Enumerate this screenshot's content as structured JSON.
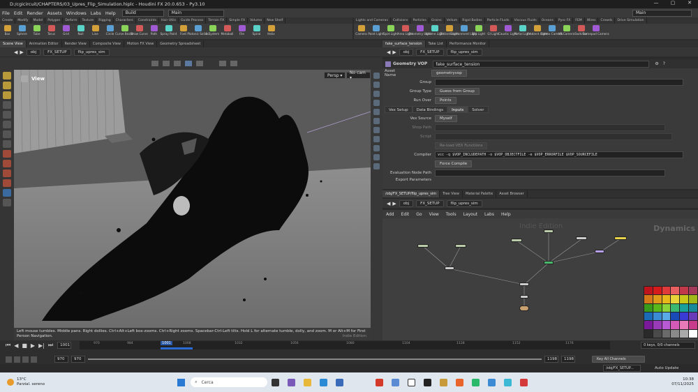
{
  "window": {
    "title": "D:/cgicircuit/CHAPTERS/03_Upres_Flip_Simulation.hiplc - Houdini FX 20.0.653 - Py3.10",
    "min": "—",
    "max": "▢",
    "close": "✕"
  },
  "menu": {
    "items": [
      "File",
      "Edit",
      "Render",
      "Assets",
      "Windows",
      "Labs",
      "Help"
    ],
    "build": "Build",
    "main_desk": "Main",
    "right_desk": "Main"
  },
  "shelf_tabs_left": [
    "Create",
    "Modify",
    "Model",
    "Polygon",
    "Deform",
    "Texture",
    "Rigging",
    "Characters",
    "Constraints",
    "Hair Utils",
    "Guide Process",
    "Terrain FX",
    "Simple FX",
    "Volume",
    "New Shelf"
  ],
  "shelf_tools_left": [
    "Box",
    "Sphere",
    "Tube",
    "Torus",
    "Grid",
    "Null",
    "Line",
    "Circle",
    "Curve Bezier",
    "Draw Curve",
    "Path",
    "Spray Paint",
    "Font",
    "Platonic Solids",
    "L-System",
    "Metaball",
    "File",
    "Spiral",
    "Helix"
  ],
  "shelf_tabs_right": [
    "Lights and Cameras",
    "Collisions",
    "Particles",
    "Grains",
    "Vellum",
    "Rigid Bodies",
    "Particle Fluids",
    "Viscous Fluids",
    "Oceans",
    "Pyro FX",
    "FEM",
    "Wires",
    "Crowds",
    "Drive Simulation"
  ],
  "shelf_tools_right": [
    "Camera",
    "Point Light",
    "Spot Light",
    "Area Light",
    "Geometry Light",
    "Volume Light",
    "Distant Light",
    "Environment Light",
    "Sky Light",
    "GI Light",
    "Caustic Light",
    "Portal Light",
    "Ambient Light",
    "Stereo Camera",
    "VR Camera",
    "Switcher",
    "Gamepad Camera"
  ],
  "left_tabs": [
    "Scene View",
    "Animation Editor",
    "Render View",
    "Composite View",
    "Motion FX View",
    "Geometry Spreadsheet"
  ],
  "left_path": {
    "ctx": "obj",
    "seg1": "FX_SETUP",
    "seg2": "flip_upres_sim"
  },
  "viewport": {
    "label": "View",
    "persp": "Persp ▾",
    "cam": "No cam ▾",
    "status": "Left mouse tumbles. Middle pans. Right dollies. Ctrl+Alt+Left box-zooms. Ctrl+Right zooms. Spacebar-Ctrl-Left tilts. Hold L for alternate tumble, dolly, and zoom. M or Alt+M for First Person Navigation.",
    "indie": "Indie Edition"
  },
  "right_tabs": [
    "fake_surface_tension",
    "Take List",
    "Performance Monitor"
  ],
  "right_path": {
    "ctx": "obj",
    "seg1": "FX_SETUP",
    "seg2": "flip_upres_sim"
  },
  "params": {
    "node_type": "Geometry VOP",
    "node_name": "fake_surface_tension",
    "asset_name_label": "Asset Name",
    "asset_name": "geometryvop",
    "group_label": "Group",
    "group_type_label": "Group Type",
    "group_type": "Guess from Group",
    "run_over_label": "Run Over",
    "run_over": "Points",
    "tabs": [
      "Vex Setup",
      "Data Bindings",
      "Inputs",
      "Solver"
    ],
    "vex_source_label": "Vex Source",
    "vex_source": "Myself",
    "shop_path_label": "Shop Path",
    "script_label": "Script",
    "reload_btn": "Re-load VEX Functions",
    "compiler_label": "Compiler",
    "compiler": "vcc -q $VOP_INCLUDEPATH -o $VOP_OBJECTFILE -e $VOP_ERRORFILE $VOP_SOURCEFILE",
    "force_compile": "Force Compile",
    "eval_node_label": "Evaluation Node Path",
    "export_label": "Export Parameters"
  },
  "net_tabs": [
    "/obj/FX_SETUP/flip_upres_sim",
    "Tree View",
    "Material Palette",
    "Asset Browser"
  ],
  "net_path": {
    "ctx": "obj",
    "seg1": "FX_SETUP",
    "seg2": "flip_upres_sim"
  },
  "net_menu": [
    "Add",
    "Edit",
    "Go",
    "View",
    "Tools",
    "Layout",
    "Labs",
    "Help"
  ],
  "net_watermark": {
    "indie": "Indie Edition",
    "ctx": "Dynamics"
  },
  "timeline": {
    "frame": "1001",
    "start": "970",
    "start2": "970",
    "end": "1198",
    "end2": "1198",
    "ticks": [
      "970",
      "984",
      "1001",
      "1008",
      "1032",
      "1056",
      "1080",
      "1104",
      "1128",
      "1152",
      "1176"
    ],
    "keys": "0 keys, 0/0 channels",
    "key_all": "Key All Channels",
    "auto_update": "Auto Update",
    "path": "/obj/FX_SETUP..."
  },
  "taskbar": {
    "temp": "13°C",
    "weather": "Parzial. sereno",
    "search": "Cerca",
    "time": "10:38",
    "date": "07/11/2025"
  },
  "palette": [
    "#c0141c",
    "#d41a1a",
    "#e03a3a",
    "#e86060",
    "#c23a4a",
    "#a33a5a",
    "#d4781a",
    "#e09a1a",
    "#e8b81a",
    "#e8d43a",
    "#c8c81a",
    "#a0b81a",
    "#3a9a1a",
    "#5ab81a",
    "#8ad43a",
    "#3ab870",
    "#1aa09a",
    "#1a8a9a",
    "#1a6ab8",
    "#3a8ad4",
    "#5aaae8",
    "#1a4ab8",
    "#3a3ad4",
    "#6a3ab8",
    "#7a1a9a",
    "#9a3ab8",
    "#b85ad4",
    "#d45ab8",
    "#e87ab8",
    "#c83a8a",
    "#2a2a2a",
    "#4a4a4a",
    "#6a6a6a",
    "#8a8a8a",
    "#aaaaaa",
    "#ffffff"
  ]
}
